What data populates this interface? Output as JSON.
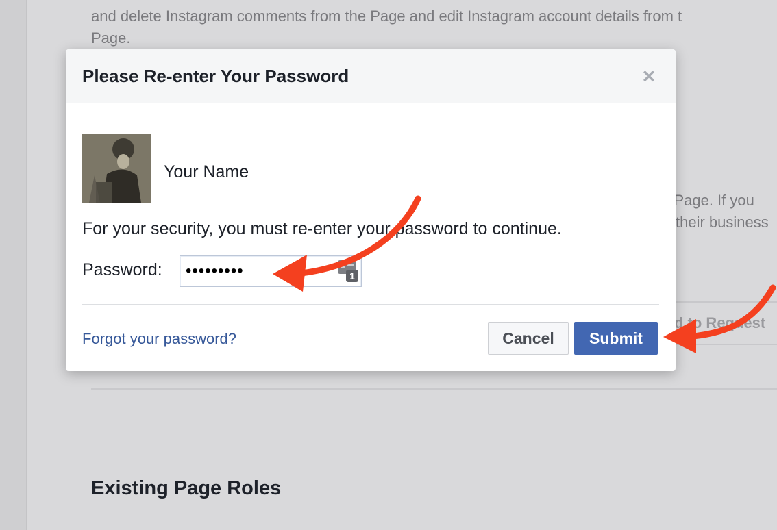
{
  "background": {
    "line1": "and delete Instagram comments from the Page and edit Instagram account details from t",
    "line2": "Page.",
    "right_line1": "r Page. If you",
    "right_line2": "their business",
    "request_button": "d to Request",
    "section_heading": "Existing Page Roles"
  },
  "dialog": {
    "title": "Please Re-enter Your Password",
    "close_icon": "close-icon",
    "user": {
      "name": "Your Name",
      "avatar": "profile-photo"
    },
    "message": "For your security, you must re-enter your password to continue.",
    "password": {
      "label": "Password:",
      "value": "•••••••••",
      "manager_badge": "1"
    },
    "forgot_link": "Forgot your password?",
    "cancel_label": "Cancel",
    "submit_label": "Submit"
  },
  "colors": {
    "submit_bg": "#4267b2",
    "link": "#365899",
    "annotation_arrow": "#f4401f"
  }
}
